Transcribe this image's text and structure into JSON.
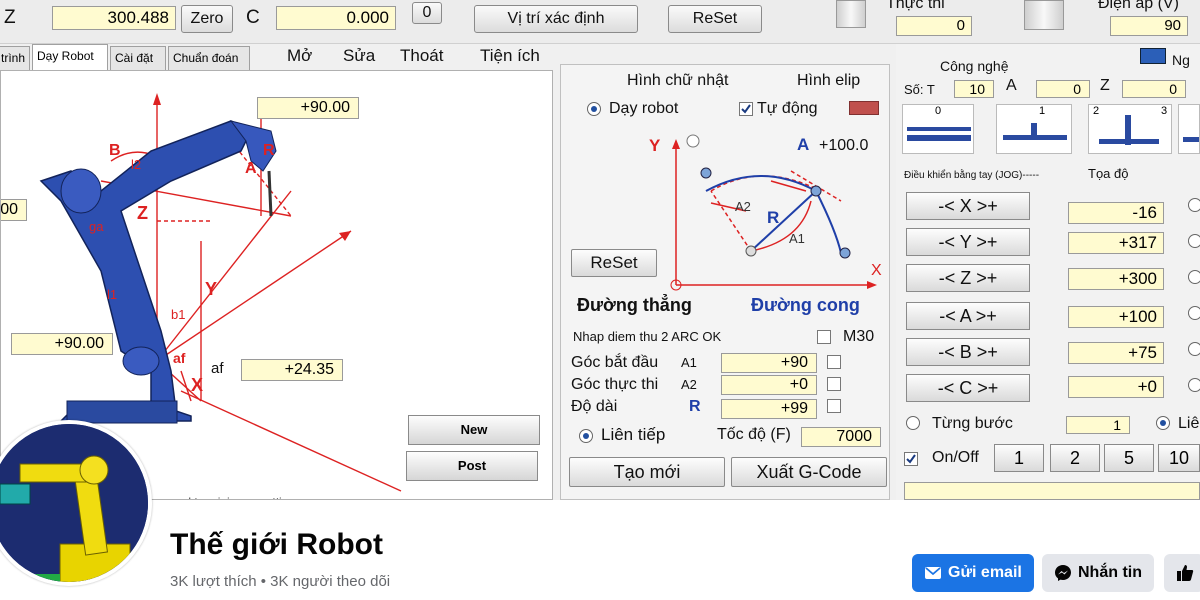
{
  "toolbar": {
    "label_z": "Z",
    "z_value": "300.488",
    "zero_label": "Zero",
    "label_c": "C",
    "c_value": "0.000",
    "small_value": "0",
    "vitri_label": "Vị trí xác định",
    "reset_label": "ReSet",
    "thucthi_label": "Thực thi",
    "thucthi_value": "0",
    "dienap_label": "Điện áp (V)",
    "dienap_value": "90"
  },
  "tabs": [
    {
      "label": "trình"
    },
    {
      "label": "Dạy Robot"
    },
    {
      "label": "Cài đặt"
    },
    {
      "label": "Chuẩn đoán"
    }
  ],
  "menu": {
    "mo": "Mở",
    "sua": "Sửa",
    "thoat": "Thoát",
    "tienich": "Tiện ích"
  },
  "robot": {
    "angle_top": "+90.00",
    "left_cut": "00",
    "angle_left": "+90.00",
    "af_label": "af",
    "af_value": "+24.35",
    "new_label": "New",
    "post_label": "Post",
    "footer_note": "mped to minimum setting",
    "diagram_labels": {
      "b": "B",
      "z": "Z",
      "y": "Y",
      "x": "X",
      "r": "R",
      "a": "A",
      "af": "af",
      "l2": "l2",
      "l1": "l1",
      "b1": "b1",
      "ga": "ga"
    }
  },
  "mid": {
    "hinh_chu_nhat": "Hình chữ nhật",
    "hinh_elip": "Hình elip",
    "day_robot": "Dạy robot",
    "tu_dong": "Tự động",
    "diagram": {
      "y": "Y",
      "x": "X",
      "a": "A",
      "a_value": "+100.0",
      "a2": "A2",
      "a1": "A1",
      "r": "R"
    },
    "reset_label": "ReSet",
    "duong_thang": "Đường thẳng",
    "duong_cong": "Đường cong",
    "nhap_diem": "Nhap diem thu 2 ARC OK",
    "m30": "M30",
    "goc_bat_dau": "Góc bắt đầu",
    "a1": "A1",
    "a1_value": "+90",
    "goc_thuc_thi": "Góc thực thi",
    "a2": "A2",
    "a2_value": "+0",
    "do_dai": "Độ dài",
    "r": "R",
    "r_value": "+99",
    "lien_tiep": "Liên tiếp",
    "toc_do": "Tốc độ (F)",
    "toc_do_value": "7000",
    "tao_moi": "Tạo mới",
    "xuat_gcode": "Xuất G-Code"
  },
  "right": {
    "cong_nghe": "Công nghệ",
    "so_t": "Số: T",
    "t_value": "10",
    "a_label": "A",
    "a_value": "0",
    "z_label": "Z",
    "z_value": "0",
    "ng_label": "Ng",
    "icons": [
      "0",
      "1",
      "2",
      "3"
    ],
    "jog_title": "Điều khiển bằng tay (JOG)-----",
    "toa_do": "Tọa độ",
    "jog": [
      {
        "label": "-< X >+",
        "value": "-16"
      },
      {
        "label": "-< Y >+",
        "value": "+317"
      },
      {
        "label": "-< Z >+",
        "value": "+300"
      },
      {
        "label": "-< A >+",
        "value": "+100"
      },
      {
        "label": "-< B >+",
        "value": "+75"
      },
      {
        "label": "-< C >+",
        "value": "+0"
      }
    ],
    "tung_buoc": "Từng bước",
    "tung_buoc_value": "1",
    "lien": "Liê",
    "onoff": "On/Off",
    "steps": [
      "1",
      "2",
      "5",
      "10"
    ]
  },
  "fb": {
    "page_name": "Thế giới Robot",
    "stats": "3K lượt thích • 3K người theo dõi",
    "email_btn": "Gửi email",
    "message_btn": "Nhắn tin"
  },
  "colors": {
    "accent_blue": "#1b74e4",
    "cell_yellow": "#fffbd0",
    "robot_blue": "#2d4fb0",
    "diagram_red": "#d22"
  }
}
